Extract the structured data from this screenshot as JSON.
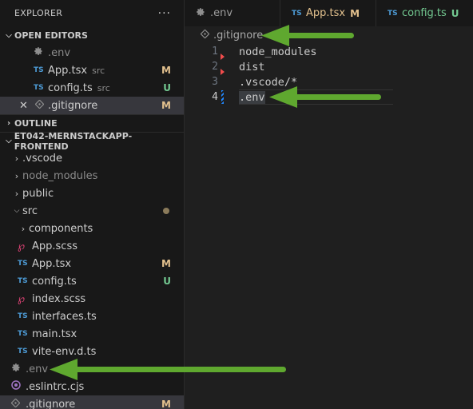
{
  "explorer": {
    "title": "EXPLORER",
    "more": "···",
    "open_editors": {
      "title": "OPEN EDITORS",
      "items": [
        {
          "icon": "gear-icon",
          "label": ".env",
          "desc": "",
          "badge": ""
        },
        {
          "icon": "TS",
          "label": "App.tsx",
          "desc": "src",
          "badge": "M"
        },
        {
          "icon": "TS",
          "label": "config.ts",
          "desc": "src",
          "badge": "U"
        },
        {
          "icon": "gitignore-icon",
          "label": ".gitignore",
          "desc": "",
          "badge": "M"
        }
      ]
    },
    "outline": {
      "title": "OUTLINE"
    },
    "project": {
      "title": "ET042-MERNSTACKAPP-FRONTEND",
      "items": [
        {
          "label": ".vscode",
          "badge": ""
        },
        {
          "label": "node_modules",
          "badge": ""
        },
        {
          "label": "public",
          "badge": ""
        },
        {
          "label": "src",
          "badge": ""
        },
        {
          "label": "components",
          "badge": ""
        },
        {
          "label": "App.scss",
          "badge": ""
        },
        {
          "label": "App.tsx",
          "badge": "M"
        },
        {
          "label": "config.ts",
          "badge": "U"
        },
        {
          "label": "index.scss",
          "badge": ""
        },
        {
          "label": "interfaces.ts",
          "badge": ""
        },
        {
          "label": "main.tsx",
          "badge": ""
        },
        {
          "label": "vite-env.d.ts",
          "badge": ""
        },
        {
          "label": ".env",
          "badge": ""
        },
        {
          "label": ".eslintrc.cjs",
          "badge": ""
        },
        {
          "label": ".gitignore",
          "badge": "M"
        }
      ]
    }
  },
  "tabs": [
    {
      "icon": "gear-icon",
      "label": ".env",
      "badge": ""
    },
    {
      "icon": "TS",
      "label": "App.tsx",
      "badge": "M"
    },
    {
      "icon": "TS",
      "label": "config.ts",
      "badge": "U"
    }
  ],
  "ts_icon_text": "TS",
  "breadcrumb": ".gitignore",
  "editor_lines": [
    {
      "num": "1",
      "text": "node_modules"
    },
    {
      "num": "2",
      "text": "dist"
    },
    {
      "num": "3",
      "text": ".vscode/*"
    },
    {
      "num": "4",
      "text": ".env"
    }
  ],
  "colors": {
    "modified": "#e2c08d",
    "untracked": "#73c991",
    "ts_blue": "#4d9bd6",
    "arrow_green": "#5fa82f",
    "selection": "#37373d"
  }
}
